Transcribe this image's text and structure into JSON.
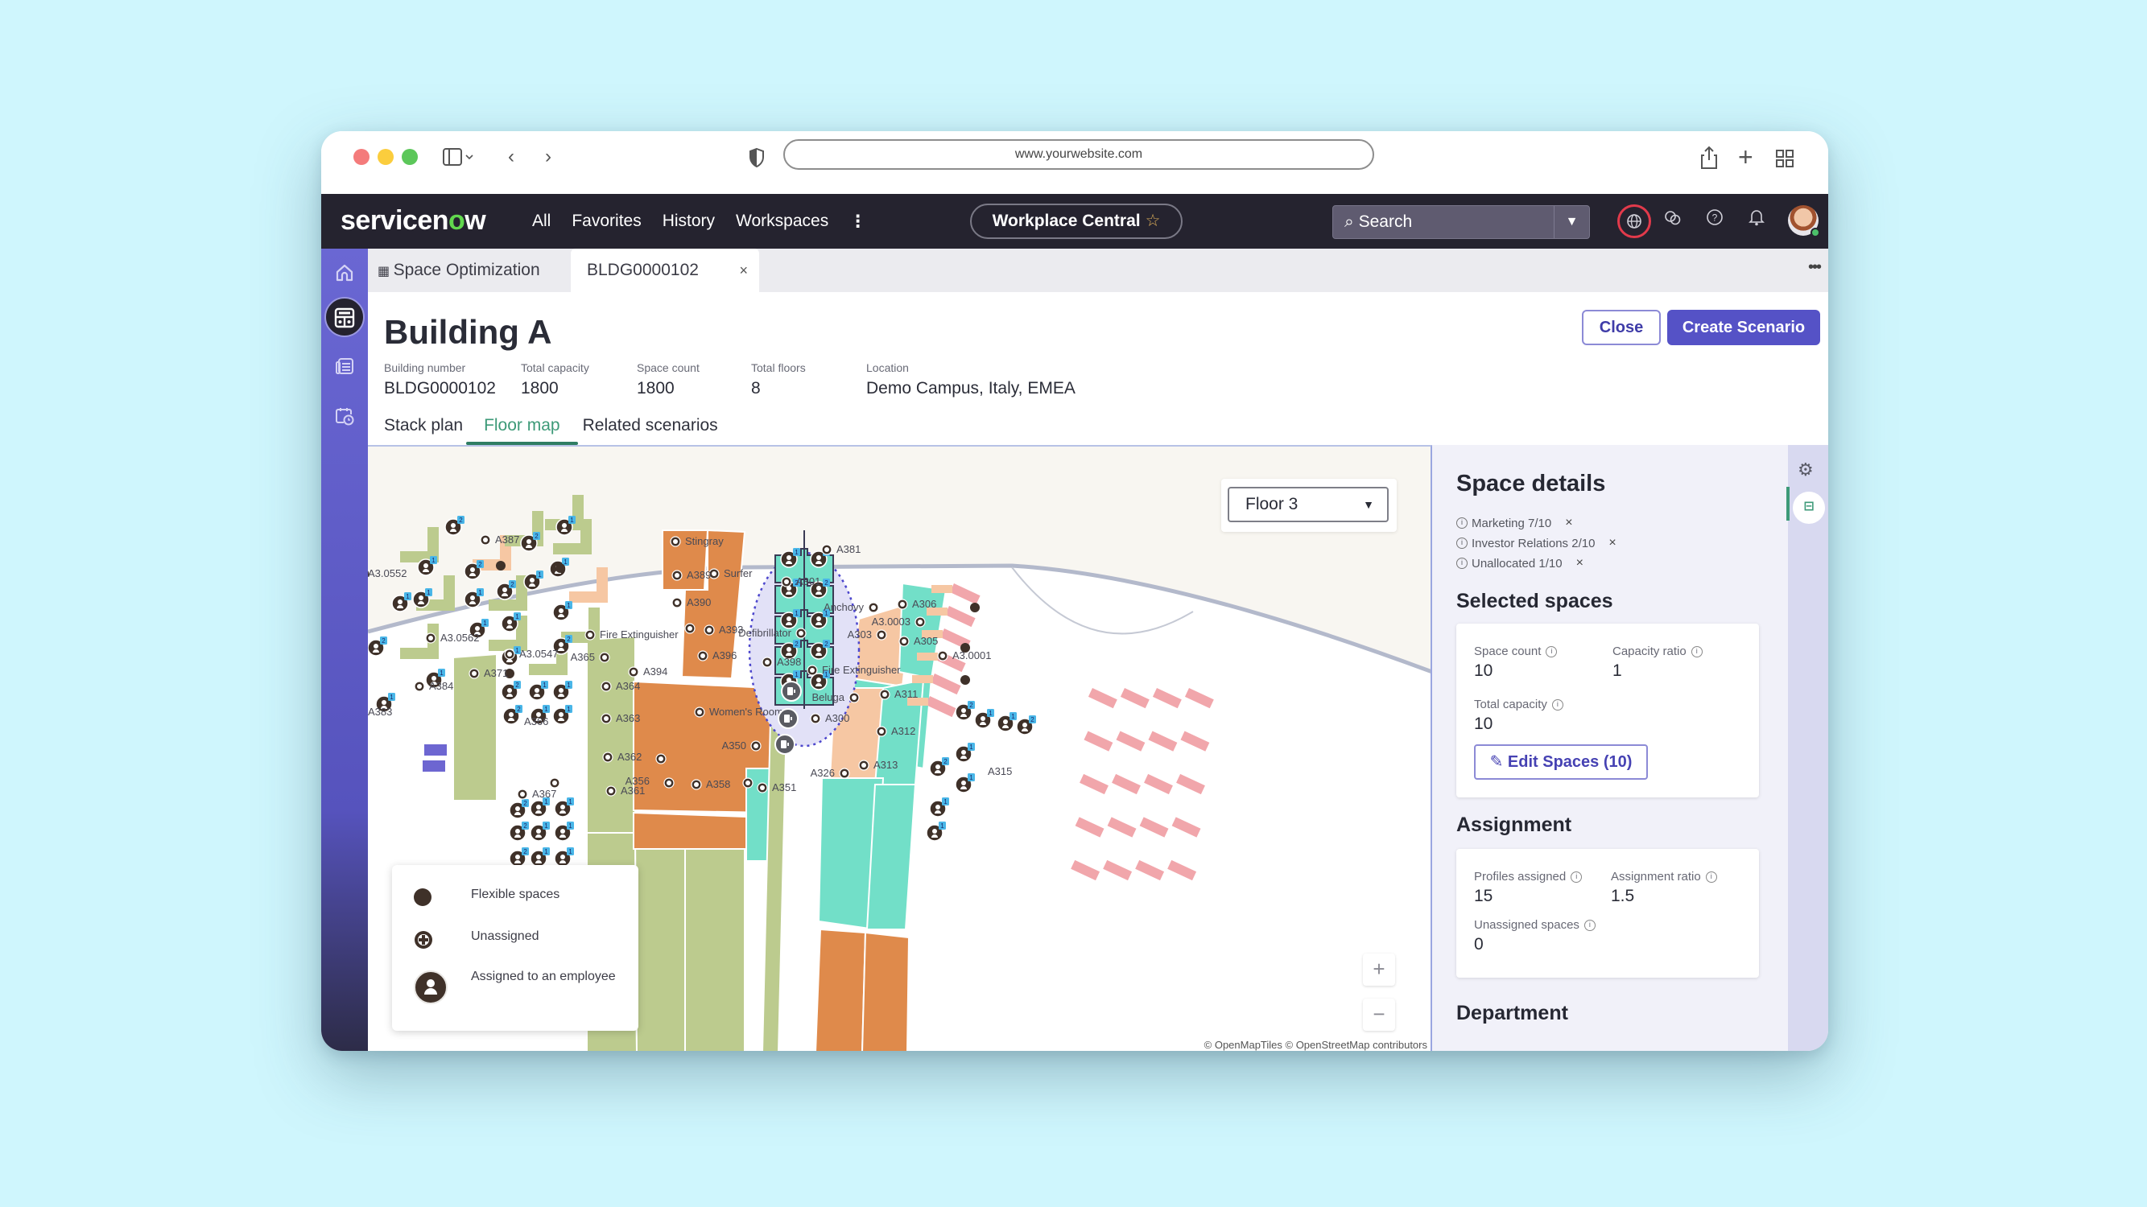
{
  "browser": {
    "url": "www.yourwebsite.com"
  },
  "header": {
    "logo_prefix": "servicen",
    "logo_o": "o",
    "logo_suffix": "w",
    "nav": [
      "All",
      "Favorites",
      "History",
      "Workspaces"
    ],
    "more": "⋮",
    "workspace_pill": "Workplace Central",
    "search_placeholder": "Search"
  },
  "tabs": [
    {
      "label": "Space Optimization"
    },
    {
      "label": "BLDG0000102",
      "closable": true
    }
  ],
  "page": {
    "title": "Building A",
    "close_label": "Close",
    "create_label": "Create Scenario",
    "meta": [
      {
        "label": "Building number",
        "value": "BLDG0000102"
      },
      {
        "label": "Total capacity",
        "value": "1800"
      },
      {
        "label": "Space count",
        "value": "1800"
      },
      {
        "label": "Total floors",
        "value": "8"
      },
      {
        "label": "Location",
        "value": "Demo Campus, Italy, EMEA"
      }
    ],
    "subtabs": [
      {
        "label": "Stack plan",
        "active": false
      },
      {
        "label": "Floor map",
        "active": true
      },
      {
        "label": "Related scenarios",
        "active": false
      }
    ]
  },
  "map": {
    "floor_selected": "Floor 3",
    "legend": [
      {
        "icon": "flexible-space-icon",
        "label": "Flexible spaces"
      },
      {
        "icon": "unassigned-icon",
        "label": "Unassigned"
      },
      {
        "icon": "assigned-employee-icon",
        "label": "Assigned to an employee"
      }
    ],
    "zoom_in": "+",
    "zoom_out": "−",
    "attribution": "© OpenMapTiles © OpenStreetMap contributors",
    "colors": {
      "green": "#bccb8e",
      "orange": "#df8a4b",
      "peach": "#f6c7a3",
      "teal": "#72dfc8",
      "pink": "#f1a6ab",
      "purple": "#6d66d1",
      "marker": "#3f3129",
      "badge": "#49b6e8",
      "selection": "#e2e1f7"
    },
    "room_labels": [
      "A387",
      "A381",
      "A3.0552",
      "A3.0562",
      "Stingray",
      "Surfer",
      "A389",
      "A390",
      "A301",
      "A393",
      "Defibrillator",
      "Fire Extinguisher",
      "Anchovy",
      "A306",
      "A3.0003",
      "A303",
      "A305",
      "A3.0001",
      "A3.0547",
      "A365",
      "A394",
      "A396",
      "A398",
      "A371",
      "A384",
      "A383",
      "A364",
      "A363",
      "A362",
      "A361",
      "A356",
      "A358",
      "A351",
      "A350",
      "Women's Room",
      "Beluga",
      "A311",
      "A300",
      "A312",
      "A326",
      "A313",
      "A315",
      "A367",
      "A366"
    ]
  },
  "panel": {
    "title": "Space details",
    "departments": [
      {
        "label": "Marketing 7/10"
      },
      {
        "label": "Investor Relations 2/10"
      },
      {
        "label": "Unallocated 1/10"
      }
    ],
    "selected_spaces": {
      "title": "Selected spaces",
      "space_count_label": "Space count",
      "space_count": "10",
      "capacity_ratio_label": "Capacity ratio",
      "capacity_ratio": "1",
      "total_capacity_label": "Total capacity",
      "total_capacity": "10",
      "edit_label": "Edit Spaces (10)"
    },
    "assignment": {
      "title": "Assignment",
      "profiles_assigned_label": "Profiles assigned",
      "profiles_assigned": "15",
      "assignment_ratio_label": "Assignment ratio",
      "assignment_ratio": "1.5",
      "unassigned_label": "Unassigned spaces",
      "unassigned": "0"
    },
    "department_title": "Department"
  }
}
